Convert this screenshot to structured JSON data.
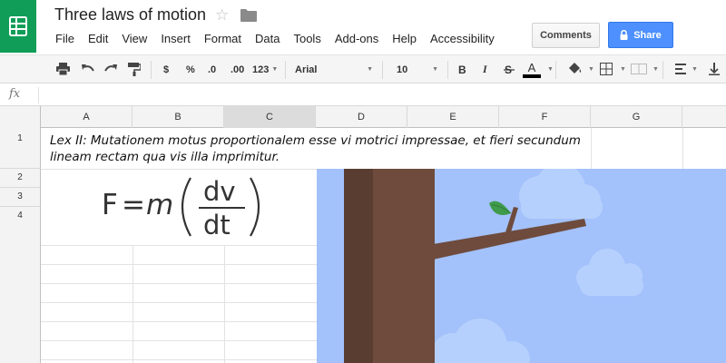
{
  "header": {
    "title": "Three laws of motion",
    "menu": [
      "File",
      "Edit",
      "View",
      "Insert",
      "Format",
      "Data",
      "Tools",
      "Add-ons",
      "Help",
      "Accessibility"
    ],
    "comments_label": "Comments",
    "share_label": "Share"
  },
  "toolbar": {
    "currency": "$",
    "percent": "%",
    "decrease_decimal": ".0",
    "increase_decimal": ".00",
    "number_format": "123",
    "font": "Arial",
    "font_size": "10",
    "bold": "B",
    "italic": "I",
    "text_color": "A"
  },
  "formula_bar": {
    "icon": "fx"
  },
  "grid": {
    "columns": [
      "A",
      "B",
      "C",
      "D",
      "E",
      "F",
      "G"
    ],
    "selected_column": "C",
    "rows": [
      "1",
      "2",
      "3",
      "4"
    ],
    "cells": {
      "A1": "Lex II: Mutationem motus proportionalem esse vi motrici impressae, et fieri secundum lineam rectam qua vis illa imprimitur."
    }
  },
  "formula_image": {
    "lhs": "F",
    "equals": "=",
    "mass": "m",
    "numerator": "dv",
    "denominator": "dt"
  },
  "colors": {
    "brand_green": "#0f9d58",
    "share_blue": "#4d90fe",
    "sky": "#a3c1fb",
    "trunk": "#6e4b3d",
    "trunk_shadow": "#5a3d31",
    "leaf": "#3f9b4b"
  }
}
